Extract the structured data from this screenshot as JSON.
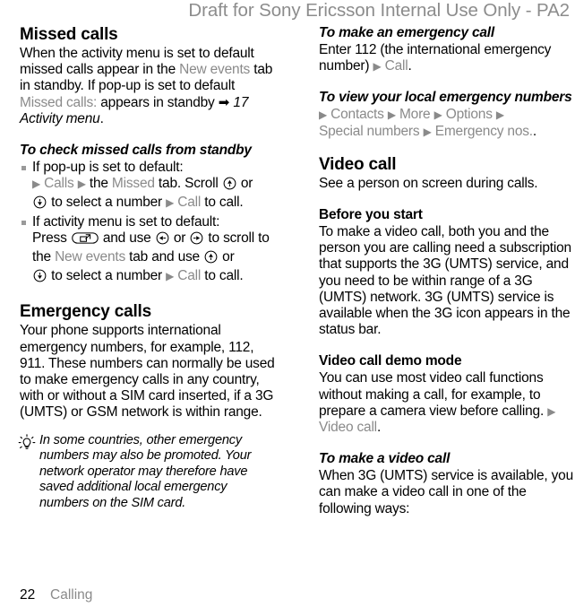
{
  "header": {
    "draft_notice": "Draft for Sony Ericsson Internal Use Only - PA2"
  },
  "footer": {
    "page_number": "22",
    "section": "Calling"
  },
  "left_column": {
    "missed_calls": {
      "heading": "Missed calls",
      "p1_a": "When the activity menu is set to default missed calls appear in the ",
      "p1_ui1": "New events",
      "p1_b": " tab in standby. If pop-up is set to default ",
      "p1_ui2": "Missed calls:",
      "p1_c": " appears in standby ",
      "p1_arrow": "➡",
      "p1_xref": "17 Activity menu",
      "p1_d": "."
    },
    "check_missed": {
      "heading": "To check missed calls from standby",
      "bullet1_l1": "If pop-up is set to default:",
      "bullet1_arrow1": "▶",
      "bullet1_ui1": "Calls",
      "bullet1_arrow2": "▶",
      "bullet1_t1": " the ",
      "bullet1_ui2": "Missed",
      "bullet1_t2": " tab. Scroll ",
      "bullet1_icon1": "scroll-up-key",
      "bullet1_t3": " or ",
      "bullet1_icon2": "scroll-down-key",
      "bullet1_t4": " to select a number ",
      "bullet1_arrow3": "▶",
      "bullet1_ui3": "Call",
      "bullet1_t5": " to call.",
      "bullet2_l1": "If activity menu is set to default:",
      "bullet2_t1": "Press ",
      "bullet2_icon1": "activity-menu-key",
      "bullet2_t2": " and use ",
      "bullet2_icon2": "scroll-left-key",
      "bullet2_t3": " or ",
      "bullet2_icon3": "scroll-right-key",
      "bullet2_t4": " to scroll to the ",
      "bullet2_ui1": "New events",
      "bullet2_t5": " tab and use ",
      "bullet2_icon4": "scroll-up-key",
      "bullet2_t6": " or ",
      "bullet2_icon5": "scroll-down-key",
      "bullet2_t7": " to select a number ",
      "bullet2_arrow1": "▶",
      "bullet2_ui2": "Call",
      "bullet2_t8": " to call."
    },
    "emergency_calls": {
      "heading": "Emergency calls",
      "paragraph": "Your phone supports international emergency numbers, for example, 112, 911. These numbers can normally be used to make emergency calls in any country, with or without a SIM card inserted, if a 3G (UMTS) or GSM network is within range."
    },
    "tip_note": {
      "icon": "lightbulb-tip-icon",
      "text": "In some countries, other emergency numbers may also be promoted. Your network operator may therefore have saved additional local emergency numbers on the SIM card."
    }
  },
  "right_column": {
    "make_emergency": {
      "heading": "To make an emergency call",
      "t1": "Enter 112 (the international emergency number) ",
      "arrow1": "▶",
      "ui1": "Call",
      "t2": "."
    },
    "view_local_emergency": {
      "heading": "To view your local emergency numbers",
      "arrow1": "▶",
      "ui1": "Contacts",
      "arrow2": "▶",
      "ui2": "More",
      "arrow3": "▶",
      "ui3": "Options",
      "arrow4": "▶",
      "ui4": "Special numbers",
      "arrow5": "▶",
      "ui5": "Emergency nos.",
      "t_end": "."
    },
    "video_call": {
      "heading": "Video call",
      "paragraph": "See a person on screen during calls."
    },
    "before_you_start": {
      "heading": "Before you start",
      "paragraph": "To make a video call, both you and the person you are calling need a subscription that supports the 3G (UMTS) service, and you need to be within range of a 3G (UMTS) network. 3G (UMTS) service is available when the 3G icon appears in the status bar."
    },
    "demo_mode": {
      "heading": "Video call demo mode",
      "t1": "You can use most video call functions without making a call, for example, to prepare a camera view before calling. ",
      "arrow1": "▶",
      "ui1": "Video call",
      "t2": "."
    },
    "make_video_call": {
      "heading": "To make a video call",
      "paragraph": "When 3G (UMTS) service is available, you can make a video call in one of the following ways:"
    }
  },
  "colors": {
    "ui_gray": "#8a8a8a",
    "draft_gray": "#8c8c8c",
    "text_black": "#000000",
    "page_bg": "#ffffff"
  }
}
